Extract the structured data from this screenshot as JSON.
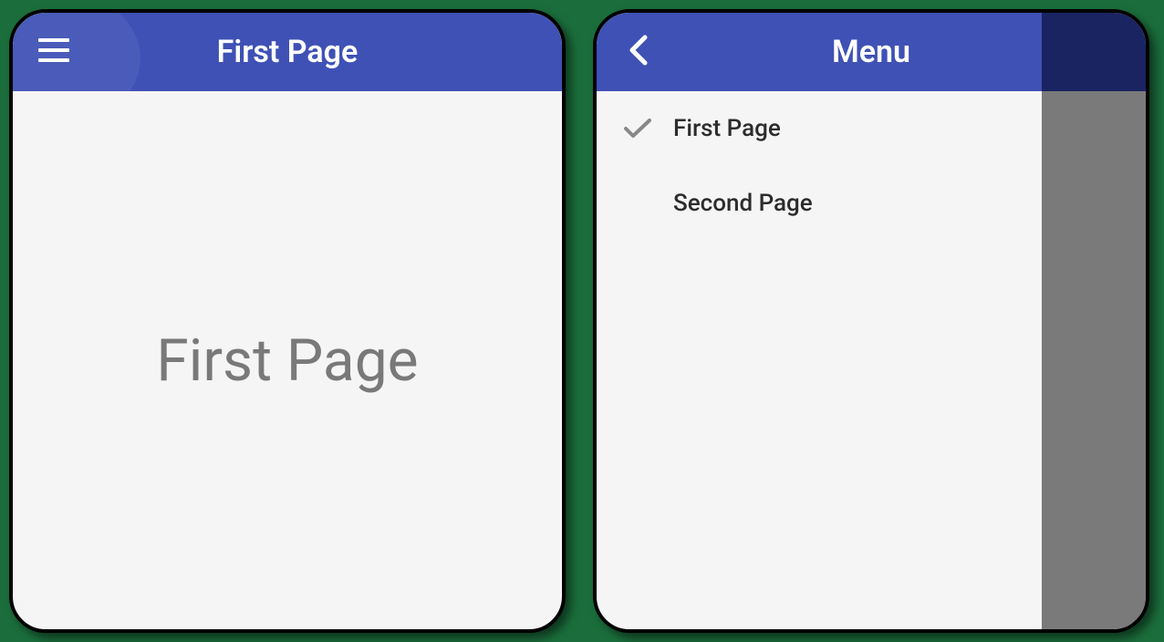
{
  "left": {
    "header_title": "First Page",
    "content_text": "First Page"
  },
  "right": {
    "header_title": "Menu",
    "menu_items": [
      {
        "label": "First Page",
        "selected": true
      },
      {
        "label": "Second Page",
        "selected": false
      }
    ]
  }
}
